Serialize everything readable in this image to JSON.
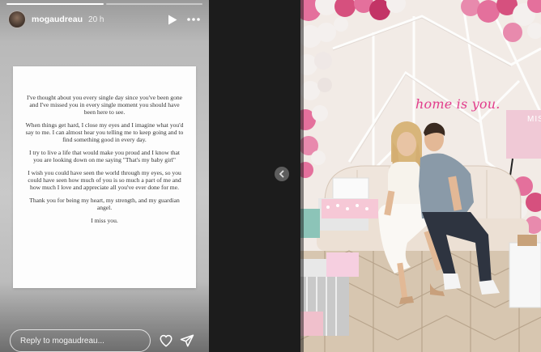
{
  "story": {
    "username": "mogaudreau",
    "time_ago": "20 h",
    "progress": {
      "segments": 2,
      "completed": 1
    },
    "icons": {
      "play": "play-icon",
      "more": "more-horizontal-icon",
      "like": "heart-icon",
      "send": "send-icon"
    },
    "card": {
      "paragraphs": [
        "I've thought about you every single day since you've been gone and I've missed you in every single moment you should have been here to see.",
        "When things get hard, I close my eyes and I imagine what you'd say to me. I can almost hear you telling me to keep going and to find something good in every day.",
        "I try to live a life that would make you proud and I know that you are looking down on me saying \"That's my baby girl\"",
        "I wish you could have seen the world through my eyes, so you could have seen how much of you is so much a part of me and how much I love and appreciate all you've ever done for me.",
        "Thank you for being my heart, my strength, and my guardian angel.",
        "I miss you."
      ]
    },
    "reply_placeholder": "Reply to mogaudreau..."
  },
  "photo": {
    "overlay_text": "home is you.",
    "sign_text": "MIS"
  },
  "nav": {
    "prev_icon": "chevron-left-icon"
  },
  "colors": {
    "overlay_pink": "#e23c8c",
    "balloon_pink": "#e4709c",
    "balloon_white": "#f4f0ee"
  }
}
